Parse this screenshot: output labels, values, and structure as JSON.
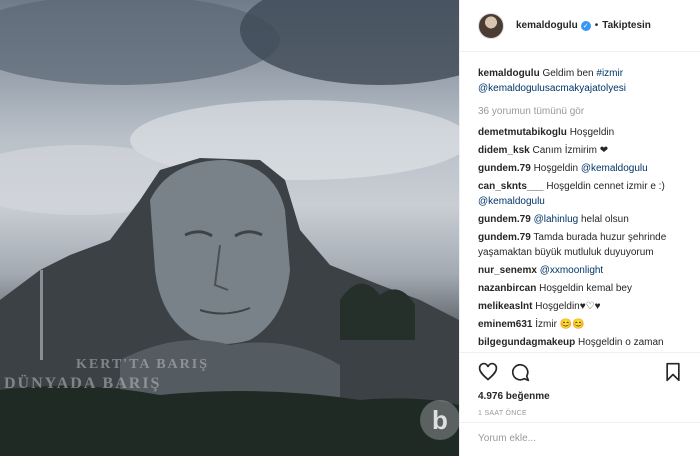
{
  "photo": {
    "line1": "KERT'TA BARIŞ",
    "line2": "DÜNYADA BARIŞ",
    "watermark": "b"
  },
  "header": {
    "username": "kemaldogulu",
    "verified_icon": "check",
    "separator": "•",
    "follow_label": "Takiptesin"
  },
  "caption": {
    "username": "kemaldogulu",
    "text": "Geldim ben",
    "hashtag": "#izmir",
    "mention": "@kemaldogulusacmakyajatolyesi"
  },
  "view_all": "36 yorumun tümünü gör",
  "comments": [
    {
      "user": "demetmutabikoglu",
      "text": "Hoşgeldin"
    },
    {
      "user": "didem_ksk",
      "text": "Canım İzmirim ❤"
    },
    {
      "user": "gundem.79",
      "text": "Hoşgeldin",
      "mention": "@kemaldogulu"
    },
    {
      "user": "can_sknts___",
      "text": "Hoşgeldin cennet izmir e :)",
      "mention": "@kemaldogulu"
    },
    {
      "user": "gundem.79",
      "mention": "@lahinlug",
      "text": "helal olsun"
    },
    {
      "user": "gundem.79",
      "text": "Tamda burada huzur şehrinde yaşamaktan büyük mutluluk duyuyorum"
    },
    {
      "user": "nur_senemx",
      "mention": "@xxmoonlight"
    },
    {
      "user": "nazanbircan",
      "text": "Hoşgeldin kemal bey"
    },
    {
      "user": "melikeaslnt",
      "text": "Hoşgeldin♥♡♥"
    },
    {
      "user": "eminem631",
      "text": "İzmir 😊😊"
    },
    {
      "user": "bilgegundagmakeup",
      "text": "Hoşgeldin o zaman"
    }
  ],
  "actions": {
    "like_icon": "heart-outline",
    "comment_icon": "comment-bubble",
    "save_icon": "bookmark-outline",
    "likes": "4.976 beğenme",
    "time": "1 SAAT ÖNCE"
  },
  "add_comment": {
    "placeholder": "Yorum ekle..."
  }
}
